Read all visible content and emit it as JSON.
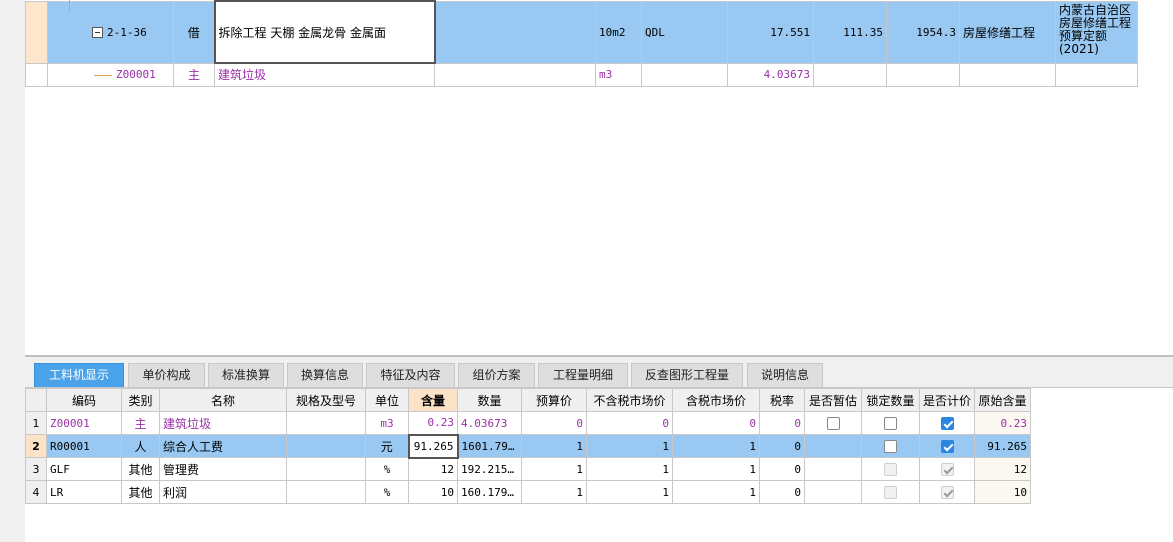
{
  "top_rows": [
    {
      "code": "2-1-36",
      "type": "借",
      "name": "拆除工程 天棚 金属龙骨 金属面",
      "spec": "",
      "unit": "10m2",
      "qty_expr": "QDL",
      "qty": "17.551",
      "unit_price": "111.35",
      "total": "1954.3",
      "profession": "房屋修缮工程",
      "quota": "内蒙古自治区房屋修缮工程预算定额(2021)"
    },
    {
      "code": "Z00001",
      "type": "主",
      "name": "建筑垃圾",
      "spec": "",
      "unit": "m3",
      "qty_expr": "",
      "qty": "4.03673",
      "unit_price": "",
      "total": "",
      "profession": "",
      "quota": ""
    }
  ],
  "tabs": [
    "工料机显示",
    "单价构成",
    "标准换算",
    "换算信息",
    "特征及内容",
    "组价方案",
    "工程量明细",
    "反查图形工程量",
    "说明信息"
  ],
  "columns": [
    "编码",
    "类别",
    "名称",
    "规格及型号",
    "单位",
    "含量",
    "数量",
    "预算价",
    "不含税市场价",
    "含税市场价",
    "税率",
    "是否暂估",
    "锁定数量",
    "是否计价",
    "原始含量"
  ],
  "rows": [
    {
      "idx": "1",
      "code": "Z00001",
      "cat": "主",
      "name": "建筑垃圾",
      "spec": "",
      "unit": "m3",
      "content": "0.23",
      "qty": "4.03673",
      "budget": "0",
      "mkt_ex": "0",
      "mkt_in": "0",
      "tax": "0",
      "provisional": false,
      "lock": false,
      "priced": true,
      "orig": "0.23"
    },
    {
      "idx": "2",
      "code": "R00001",
      "cat": "人",
      "name": "综合人工费",
      "spec": "",
      "unit": "元",
      "content": "91.265",
      "qty": "1601.79…",
      "budget": "1",
      "mkt_ex": "1",
      "mkt_in": "1",
      "tax": "0",
      "provisional": false,
      "lock": false,
      "priced": true,
      "orig": "91.265"
    },
    {
      "idx": "3",
      "code": "GLF",
      "cat": "其他",
      "name": "管理费",
      "spec": "",
      "unit": "%",
      "content": "12",
      "qty": "192.215…",
      "budget": "1",
      "mkt_ex": "1",
      "mkt_in": "1",
      "tax": "0",
      "provisional": null,
      "lock": false,
      "priced": true,
      "orig": "12"
    },
    {
      "idx": "4",
      "code": "LR",
      "cat": "其他",
      "name": "利润",
      "spec": "",
      "unit": "%",
      "content": "10",
      "qty": "160.179…",
      "budget": "1",
      "mkt_ex": "1",
      "mkt_in": "1",
      "tax": "0",
      "provisional": null,
      "lock": false,
      "priced": true,
      "orig": "10"
    }
  ],
  "colors": {
    "selected_row": "#99c9f2",
    "active_tab": "#4aa3ea",
    "main_material_text": "#9b30a6",
    "header_highlight": "#fbe3c7"
  }
}
